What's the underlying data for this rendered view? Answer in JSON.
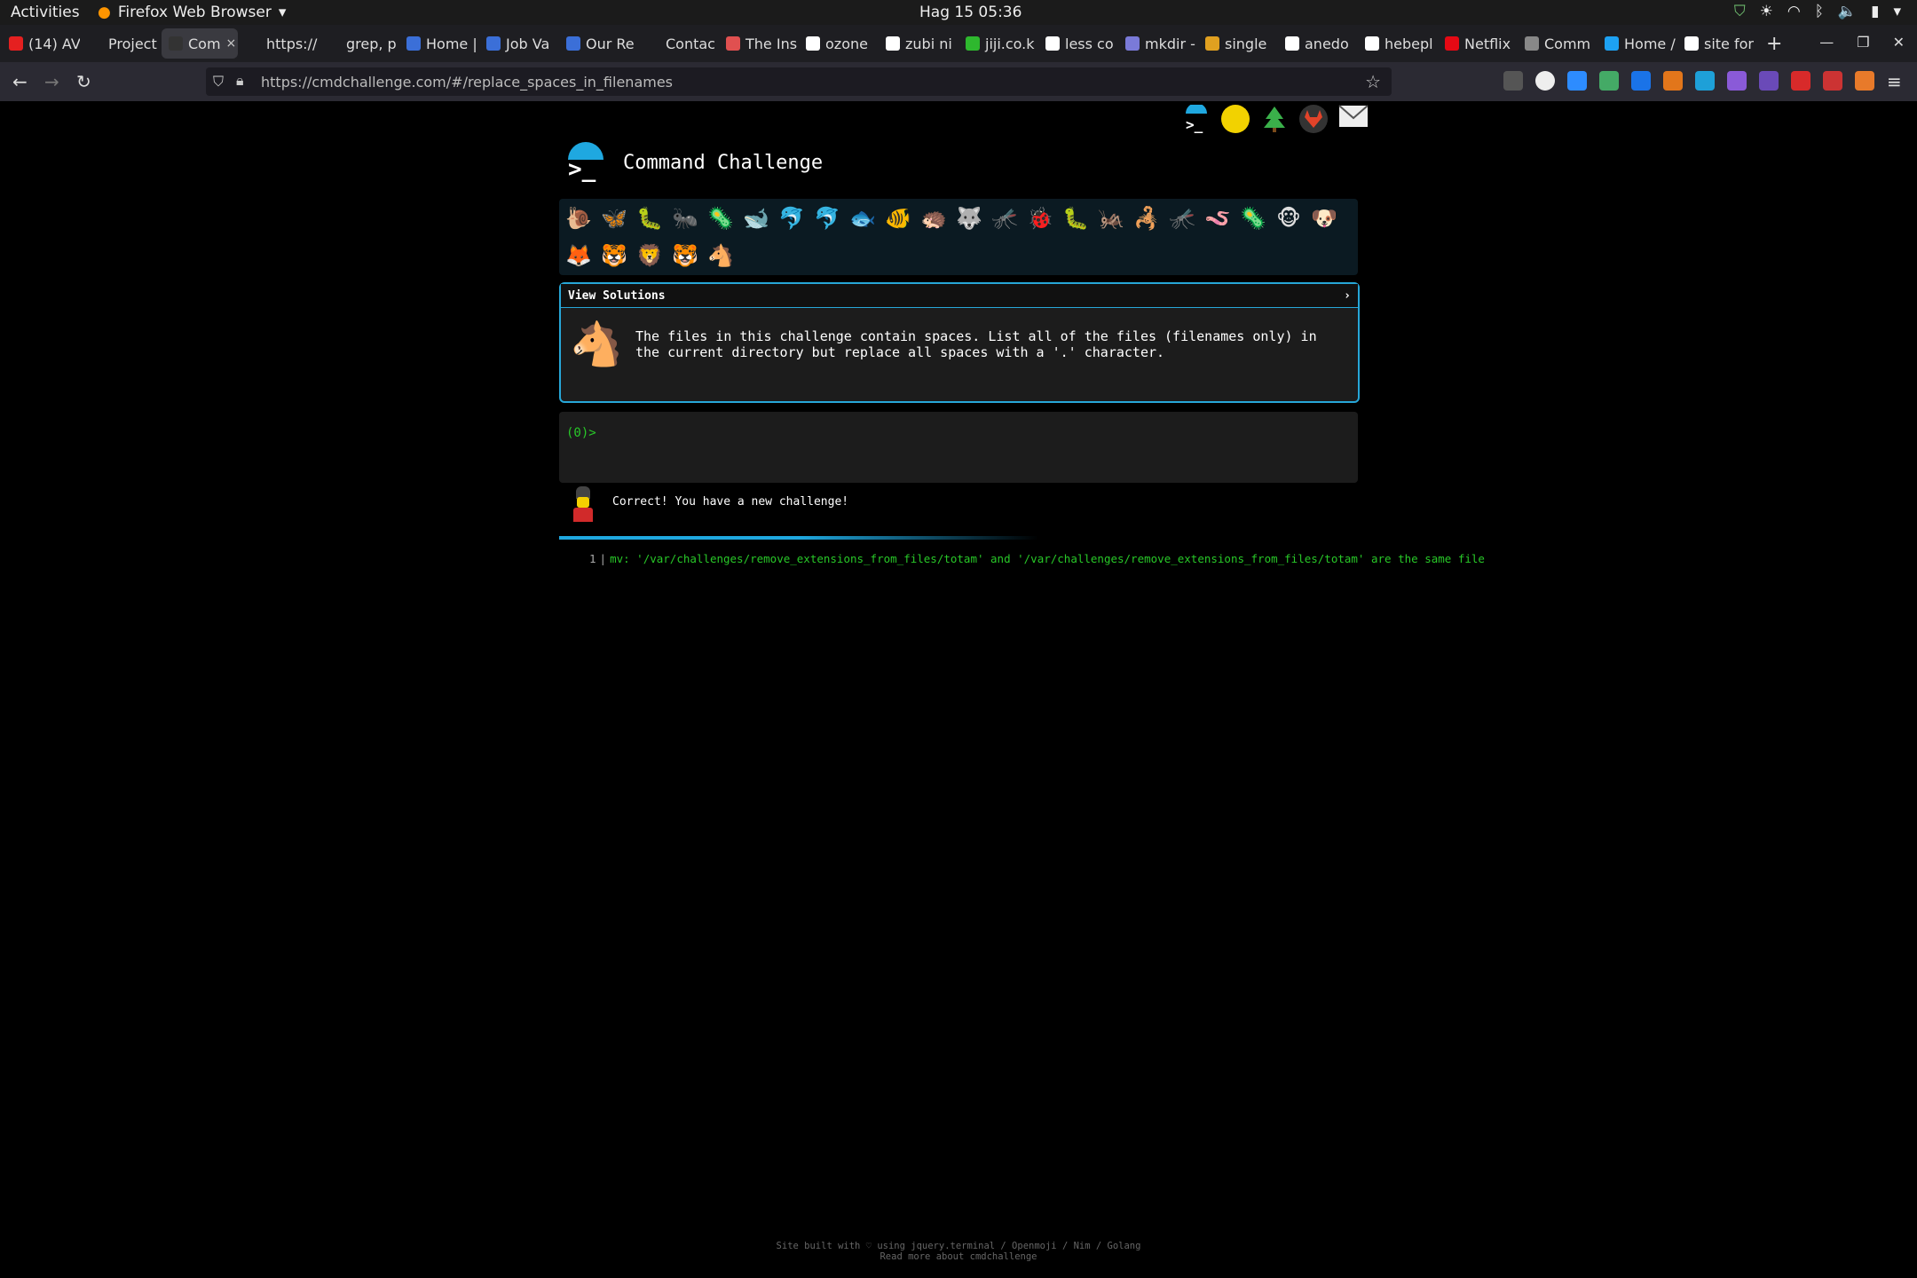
{
  "system_bar": {
    "activities": "Activities",
    "app_name": "Firefox Web Browser",
    "clock": "Hag 15  05:36"
  },
  "tabs": [
    {
      "label": "(14) AV",
      "favicon_color": "#e52020",
      "active": false
    },
    {
      "label": "Project",
      "favicon_color": "#1e1e22",
      "active": false
    },
    {
      "label": "Com",
      "favicon_color": "#333333",
      "active": true
    },
    {
      "label": "https://cm",
      "favicon_color": "#1e1e22",
      "active": false
    },
    {
      "label": "grep, print",
      "favicon_color": "#1e1e22",
      "active": false
    },
    {
      "label": "Home |",
      "favicon_color": "#3b6fd8",
      "active": false
    },
    {
      "label": "Job Va",
      "favicon_color": "#3b6fd8",
      "active": false
    },
    {
      "label": "Our Re",
      "favicon_color": "#3b6fd8",
      "active": false
    },
    {
      "label": "Contac",
      "favicon_color": "#1e1e22",
      "active": false
    },
    {
      "label": "The Ins",
      "favicon_color": "#e05050",
      "active": false
    },
    {
      "label": "ozone",
      "favicon_color": "#ffffff",
      "active": false
    },
    {
      "label": "zubi ni",
      "favicon_color": "#ffffff",
      "active": false
    },
    {
      "label": "jiji.co.k",
      "favicon_color": "#2eb82e",
      "active": false
    },
    {
      "label": "less co",
      "favicon_color": "#ffffff",
      "active": false
    },
    {
      "label": "mkdir -",
      "favicon_color": "#7a7ad8",
      "active": false
    },
    {
      "label": "single",
      "favicon_color": "#e0a020",
      "active": false
    },
    {
      "label": "anedo",
      "favicon_color": "#ffffff",
      "active": false
    },
    {
      "label": "hebepl",
      "favicon_color": "#ffffff",
      "active": false
    },
    {
      "label": "Netflix",
      "favicon_color": "#e50914",
      "active": false
    },
    {
      "label": "Comm",
      "favicon_color": "#888888",
      "active": false
    },
    {
      "label": "Home /",
      "favicon_color": "#1da1f2",
      "active": false
    },
    {
      "label": "site for",
      "favicon_color": "#ffffff",
      "active": false
    }
  ],
  "active_tab_close": "×",
  "new_tab": "+",
  "address_bar": {
    "url": "https://cmdchallenge.com/#/replace_spaces_in_filenames"
  },
  "page": {
    "site_title": "Command Challenge",
    "animals_row1": [
      "🐌",
      "🦋",
      "🐛",
      "🐜",
      "🦠",
      "🐋",
      "🐬",
      "🐬",
      "🐟",
      "🐠",
      "🦔",
      "🐺",
      "🦟",
      "🐞",
      "🐛",
      "🦗",
      "🦂",
      "🦟",
      "🪱",
      "🦠",
      "🐵",
      "🐶"
    ],
    "animals_row2": [
      "🦊",
      "🐯",
      "🦁",
      "🐯",
      "🐴"
    ],
    "view_solutions": "View Solutions",
    "chevron": "›",
    "challenge_icon": "🐴",
    "challenge_text": "The files in this challenge contain spaces. List all of the files (filenames only) in the current directory but replace all spaces with a '.' character.",
    "prompt": "(0)>",
    "result_message": "Correct! You have a new challenge!",
    "output_line_number": "1",
    "output_text": "mv: '/var/challenges/remove_extensions_from_files/totam' and '/var/challenges/remove_extensions_from_files/totam' are the same file",
    "footer_line1": "Site built with ♡ using jquery.terminal / Openmoji / Nim / Golang",
    "footer_line2": "Read more about cmdchallenge"
  },
  "colors": {
    "accent": "#1fa8e0",
    "prompt_green": "#28c828",
    "box_border": "#27a7d8"
  }
}
